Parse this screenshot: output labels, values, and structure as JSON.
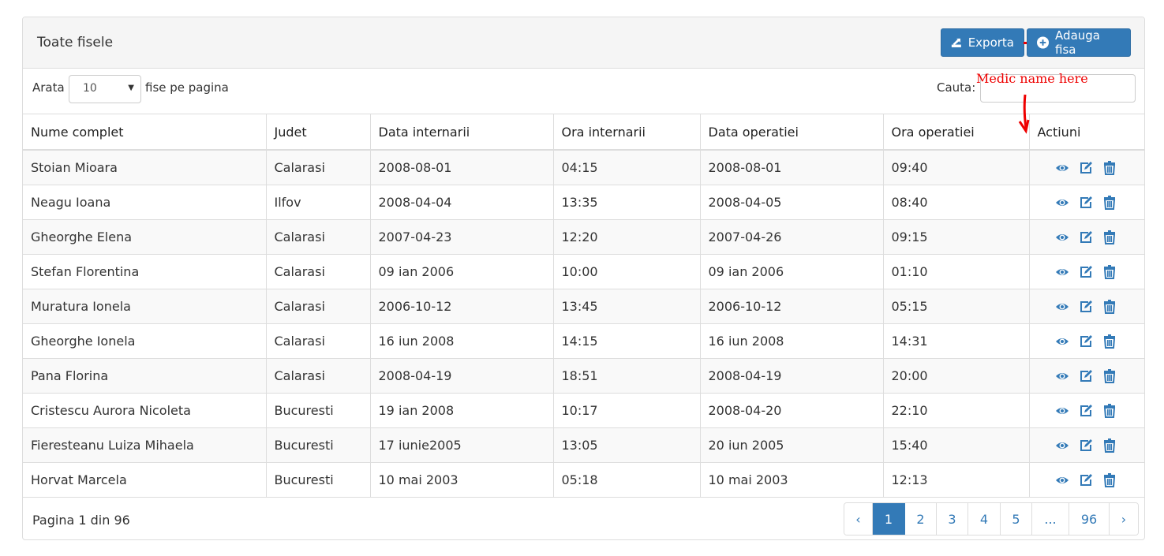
{
  "header": {
    "title": "Toate fisele",
    "export_label": "Exporta",
    "add_label": "Adauga fisa"
  },
  "controls": {
    "show_label": "Arata",
    "per_page_value": "10",
    "per_page_suffix": "fise pe pagina",
    "search_label": "Cauta:",
    "search_value": ""
  },
  "annotation": {
    "text": "Medic name here"
  },
  "table": {
    "columns": [
      "Nume complet",
      "Judet",
      "Data internarii",
      "Ora internarii",
      "Data operatiei",
      "Ora operatiei",
      "Actiuni"
    ],
    "rows": [
      [
        "Stoian Mioara",
        "Calarasi",
        "2008-08-01",
        "04:15",
        "2008-08-01",
        "09:40"
      ],
      [
        "Neagu Ioana",
        "Ilfov",
        "2008-04-04",
        "13:35",
        "2008-04-05",
        "08:40"
      ],
      [
        "Gheorghe Elena",
        "Calarasi",
        "2007-04-23",
        "12:20",
        "2007-04-26",
        "09:15"
      ],
      [
        "Stefan Florentina",
        "Calarasi",
        "09 ian 2006",
        "10:00",
        "09 ian 2006",
        "01:10"
      ],
      [
        "Muratura Ionela",
        "Calarasi",
        "2006-10-12",
        "13:45",
        "2006-10-12",
        "05:15"
      ],
      [
        "Gheorghe Ionela",
        "Calarasi",
        "16 iun 2008",
        "14:15",
        "16 iun 2008",
        "14:31"
      ],
      [
        "Pana Florina",
        "Calarasi",
        "2008-04-19",
        "18:51",
        "2008-04-19",
        "20:00"
      ],
      [
        "Cristescu Aurora Nicoleta",
        "Bucuresti",
        "19 ian 2008",
        "10:17",
        "2008-04-20",
        "22:10"
      ],
      [
        "Fieresteanu Luiza Mihaela",
        "Bucuresti",
        "17 iunie2005",
        "13:05",
        "20 iun 2005",
        "15:40"
      ],
      [
        "Horvat Marcela",
        "Bucuresti",
        "10 mai 2003",
        "05:18",
        "10 mai 2003",
        "12:13"
      ]
    ]
  },
  "footer": {
    "page_info": "Pagina 1 din 96",
    "pages": [
      "‹",
      "1",
      "2",
      "3",
      "4",
      "5",
      "...",
      "96",
      "›"
    ],
    "active_page": "1"
  },
  "colors": {
    "primary": "#337ab7",
    "annotation": "#e00000"
  },
  "icons": [
    "export-icon",
    "plus-circle-icon",
    "eye-icon",
    "edit-icon",
    "trash-icon"
  ]
}
